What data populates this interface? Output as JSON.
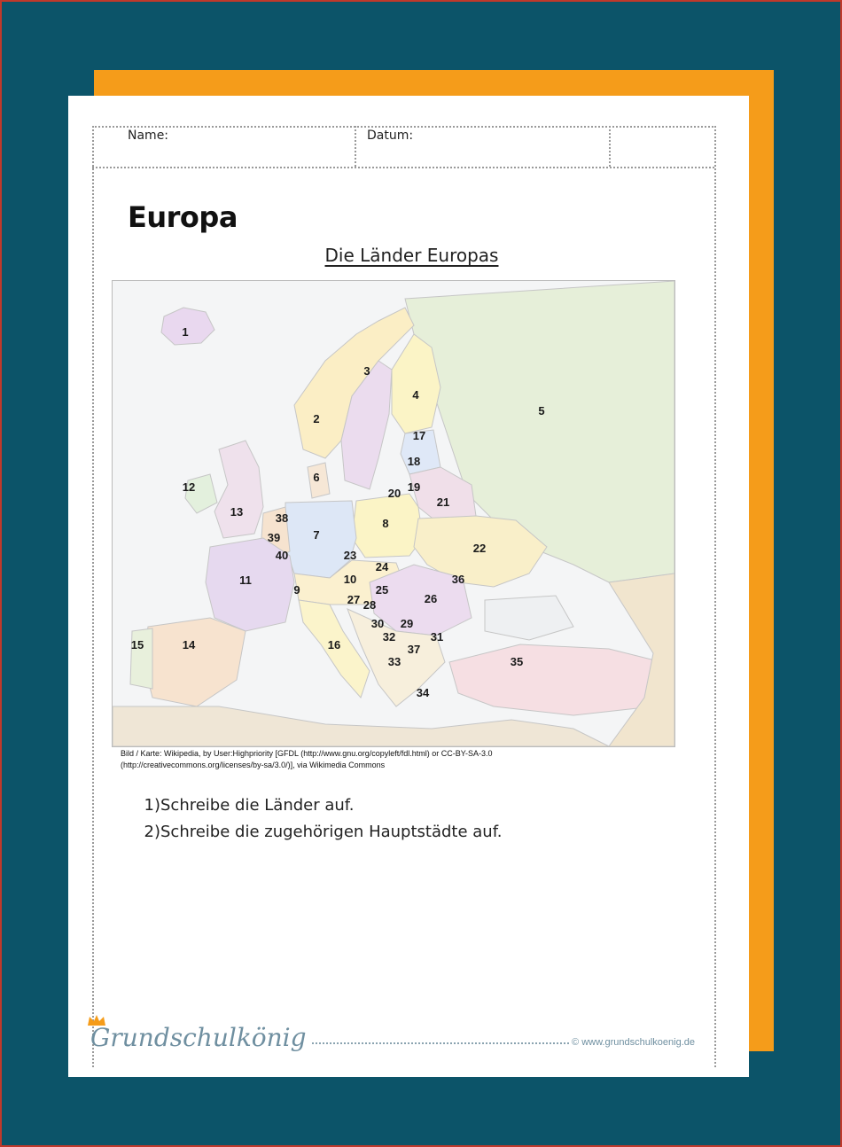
{
  "header": {
    "name_label": "Name:",
    "date_label": "Datum:"
  },
  "title": "Europa",
  "subtitle": "Die Länder Europas",
  "map": {
    "labels": [
      {
        "n": "1"
      },
      {
        "n": "2"
      },
      {
        "n": "3"
      },
      {
        "n": "4"
      },
      {
        "n": "5"
      },
      {
        "n": "6"
      },
      {
        "n": "7"
      },
      {
        "n": "8"
      },
      {
        "n": "9"
      },
      {
        "n": "10"
      },
      {
        "n": "11"
      },
      {
        "n": "12"
      },
      {
        "n": "13"
      },
      {
        "n": "14"
      },
      {
        "n": "15"
      },
      {
        "n": "16"
      },
      {
        "n": "17"
      },
      {
        "n": "18"
      },
      {
        "n": "19"
      },
      {
        "n": "20"
      },
      {
        "n": "21"
      },
      {
        "n": "22"
      },
      {
        "n": "23"
      },
      {
        "n": "24"
      },
      {
        "n": "25"
      },
      {
        "n": "26"
      },
      {
        "n": "27"
      },
      {
        "n": "28"
      },
      {
        "n": "29"
      },
      {
        "n": "30"
      },
      {
        "n": "31"
      },
      {
        "n": "32"
      },
      {
        "n": "33"
      },
      {
        "n": "34"
      },
      {
        "n": "35"
      },
      {
        "n": "36"
      },
      {
        "n": "37"
      },
      {
        "n": "38"
      },
      {
        "n": "39"
      },
      {
        "n": "40"
      }
    ]
  },
  "credit": {
    "line1": "Bild / Karte: Wikipedia, by User:Highpriority [GFDL (http://www.gnu.org/copyleft/fdl.html) or CC-BY-SA-3.0",
    "line2": "(http://creativecommons.org/licenses/by-sa/3.0/)], via Wikimedia Commons"
  },
  "tasks": [
    {
      "num": "1)",
      "text": "Schreibe die Länder auf."
    },
    {
      "num": "2)",
      "text": "Schreibe die zugehörigen Hauptstädte auf."
    }
  ],
  "footer": {
    "brand": "Grundschulkönig",
    "url": "© www.grundschulkoenig.de"
  },
  "colors": {
    "background": "#0c5469",
    "accent_orange": "#f59c1a",
    "brand_blue": "#6f8fa0"
  }
}
